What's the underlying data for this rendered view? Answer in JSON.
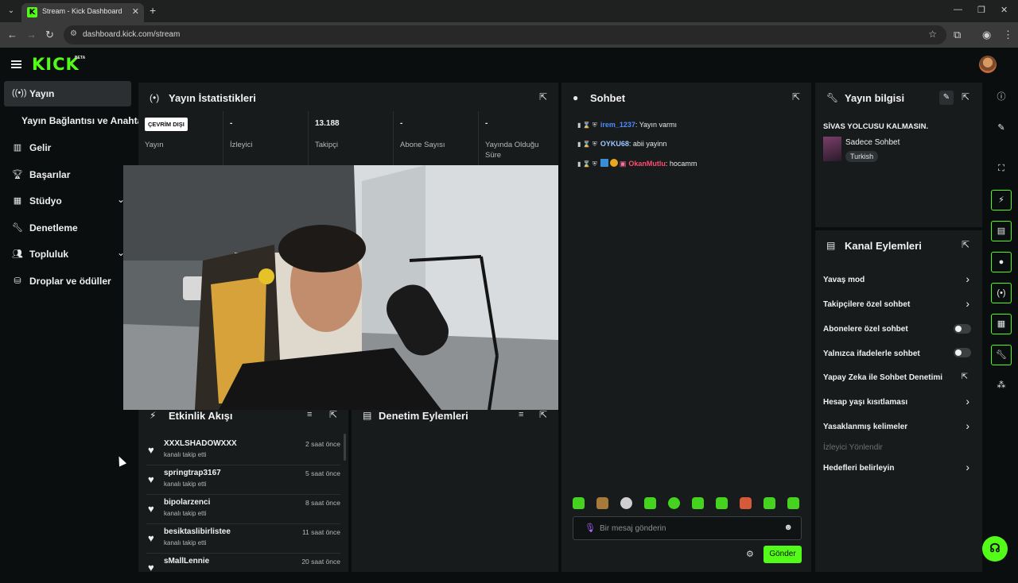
{
  "browser": {
    "tab_title": "Stream - Kick Dashboard",
    "url": "dashboard.kick.com/stream",
    "icons": [
      "tab-dropdown-icon",
      "kick-favicon",
      "close-icon",
      "plus-icon",
      "minimize-icon",
      "restore-icon",
      "close-window-icon",
      "back-icon",
      "forward-icon",
      "reload-icon",
      "site-info-icon",
      "star-icon",
      "extensions-icon",
      "profile-icon",
      "menu-dots-icon"
    ]
  },
  "header": {
    "logo": "KICK",
    "badge": "BETA"
  },
  "sidebar": {
    "items": [
      {
        "label": "Yayın",
        "icon": "broadcast-icon"
      },
      {
        "label": "Yayın Bağlantısı ve Anahtarı",
        "icon": ""
      },
      {
        "label": "Gelir",
        "icon": "revenue-icon"
      },
      {
        "label": "Başarılar",
        "icon": "trophy-icon"
      },
      {
        "label": "Stüdyo",
        "icon": "studio-icon"
      },
      {
        "label": "Denetleme",
        "icon": "wrench-icon"
      },
      {
        "label": "Topluluk",
        "icon": "community-icon"
      },
      {
        "label": "Droplar ve ödüller",
        "icon": "drops-icon"
      }
    ]
  },
  "stats": {
    "title": "Yayın İstatistikleri",
    "offline_badge": "ÇEVRİM DIŞI",
    "cells": [
      {
        "value": "",
        "label": "Yayın"
      },
      {
        "value": "-",
        "label": "İzleyici"
      },
      {
        "value": "13.188",
        "label": "Takipçi"
      },
      {
        "value": "-",
        "label": "Abone Sayısı"
      },
      {
        "value": "-",
        "label": "Yayında Olduğu Süre"
      }
    ]
  },
  "chat": {
    "title": "Sohbet",
    "messages": [
      {
        "user": "irem_1237",
        "text": ": Yayın varmı",
        "color": "#4b8bff"
      },
      {
        "user": "OYKU68",
        "text": ": abii yayinn",
        "color": "#9ec6ff"
      },
      {
        "user": "OkanMutlu",
        "text": ": hocamm",
        "color": "#ff4b6e"
      }
    ],
    "input_placeholder": "Bir mesaj gönderin",
    "send_label": "Gönder"
  },
  "stream_info": {
    "title": "Yayın bilgisi",
    "stream_title": "SİVAS YOLCUSU KALMASIN.",
    "category": "Sadece Sohbet",
    "language": "Turkish"
  },
  "channel_actions": {
    "title": "Kanal Eylemleri",
    "items": [
      {
        "label": "Yavaş mod",
        "control": "chevron"
      },
      {
        "label": "Takipçilere özel sohbet",
        "control": "chevron"
      },
      {
        "label": "Abonelere özel sohbet",
        "control": "toggle",
        "on": false
      },
      {
        "label": "Yalnızca ifadelerle sohbet",
        "control": "toggle",
        "on": false
      },
      {
        "label": "Yapay Zeka ile Sohbet Denetimi",
        "control": "external"
      },
      {
        "label": "Hesap yaşı kısıtlaması",
        "control": "chevron"
      },
      {
        "label": "Yasaklanmış kelimeler",
        "control": "chevron"
      },
      {
        "label": "İzleyici Yönlendir",
        "control": "none",
        "disabled": true
      },
      {
        "label": "Hedefleri belirleyin",
        "control": "chevron"
      }
    ]
  },
  "activity": {
    "title": "Etkinlik Akışı",
    "items": [
      {
        "name": "XXXLSHADOWXXX",
        "sub": "kanalı takip etti",
        "time": "2 saat önce"
      },
      {
        "name": "springtrap3167",
        "sub": "kanalı takip etti",
        "time": "5 saat önce"
      },
      {
        "name": "bipolarzenci",
        "sub": "kanalı takip etti",
        "time": "8 saat önce"
      },
      {
        "name": "besiktaslibirlistee",
        "sub": "kanalı takip etti",
        "time": "11 saat önce"
      },
      {
        "name": "sMallLennie",
        "sub": "",
        "time": "20 saat önce"
      }
    ]
  },
  "moderation": {
    "title": "Denetim Eylemleri"
  },
  "colors": {
    "accent": "#53fc18",
    "panel": "#181b1c",
    "background": "#0b0e0f"
  }
}
